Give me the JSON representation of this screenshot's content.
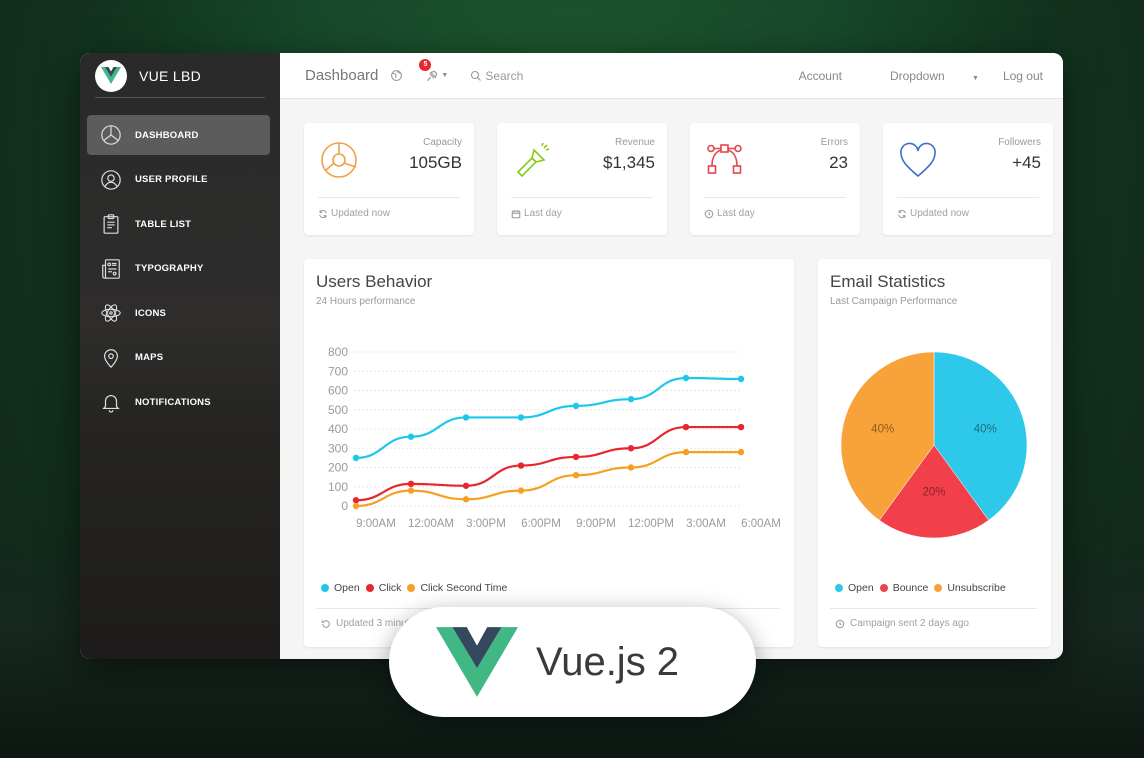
{
  "sidebar": {
    "brand": "VUE LBD",
    "items": [
      {
        "label": "DASHBOARD",
        "icon": "chart-pie-icon",
        "active": true
      },
      {
        "label": "USER PROFILE",
        "icon": "user-icon",
        "active": false
      },
      {
        "label": "TABLE LIST",
        "icon": "clipboard-icon",
        "active": false
      },
      {
        "label": "TYPOGRAPHY",
        "icon": "news-paper-icon",
        "active": false
      },
      {
        "label": "ICONS",
        "icon": "atom-icon",
        "active": false
      },
      {
        "label": "MAPS",
        "icon": "map-pin-icon",
        "active": false
      },
      {
        "label": "NOTIFICATIONS",
        "icon": "bell-icon",
        "active": false
      }
    ]
  },
  "topbar": {
    "title": "Dashboard",
    "notification_count": "5",
    "search_label": "Search",
    "account": "Account",
    "dropdown": "Dropdown",
    "logout": "Log out"
  },
  "stats": [
    {
      "category": "Capacity",
      "value": "105GB",
      "footer": "Updated now",
      "icon": "chart-icon",
      "footer_icon": "refresh-icon",
      "color": "#f0a046"
    },
    {
      "category": "Revenue",
      "value": "$1,345",
      "footer": "Last day",
      "icon": "flashlight-icon",
      "footer_icon": "calendar-icon",
      "color": "#87cb16"
    },
    {
      "category": "Errors",
      "value": "23",
      "footer": "Last day",
      "icon": "vector-icon",
      "footer_icon": "clock-icon",
      "color": "#e8434e"
    },
    {
      "category": "Followers",
      "value": "+45",
      "footer": "Updated now",
      "icon": "heart-icon",
      "footer_icon": "refresh-icon",
      "color": "#3d6ec9"
    }
  ],
  "users_card": {
    "title": "Users Behavior",
    "subtitle": "24 Hours performance",
    "footer": "Updated 3 minutes ago"
  },
  "email_card": {
    "title": "Email Statistics",
    "subtitle": "Last Campaign Performance",
    "footer": "Campaign sent 2 days ago"
  },
  "overlay": {
    "label": "Vue.js 2"
  },
  "chart_data": [
    {
      "type": "line",
      "title": "Users Behavior",
      "subtitle": "24 Hours performance",
      "categories": [
        "9:00AM",
        "12:00AM",
        "3:00PM",
        "6:00PM",
        "9:00PM",
        "12:00PM",
        "3:00AM",
        "6:00AM"
      ],
      "yticks": [
        0,
        100,
        200,
        300,
        400,
        500,
        600,
        700,
        800
      ],
      "ylim": [
        0,
        800
      ],
      "grid": true,
      "legend_position": "bottom-left",
      "series": [
        {
          "name": "Open",
          "color": "#1dc7ea",
          "values": [
            250,
            360,
            460,
            460,
            520,
            555,
            665,
            660
          ]
        },
        {
          "name": "Click",
          "color": "#e8262e",
          "values": [
            30,
            115,
            105,
            210,
            255,
            300,
            410,
            410
          ]
        },
        {
          "name": "Click Second Time",
          "color": "#f5a020",
          "values": [
            0,
            80,
            35,
            80,
            160,
            200,
            280,
            280
          ]
        }
      ]
    },
    {
      "type": "pie",
      "title": "Email Statistics",
      "subtitle": "Last Campaign Performance",
      "legend_position": "bottom-left",
      "slices": [
        {
          "name": "Open",
          "value": 40,
          "label": "40%",
          "color": "#2ec8ea"
        },
        {
          "name": "Bounce",
          "value": 20,
          "label": "20%",
          "color": "#f2404a"
        },
        {
          "name": "Unsubscribe",
          "value": 40,
          "label": "40%",
          "color": "#f8a23a"
        }
      ]
    }
  ]
}
